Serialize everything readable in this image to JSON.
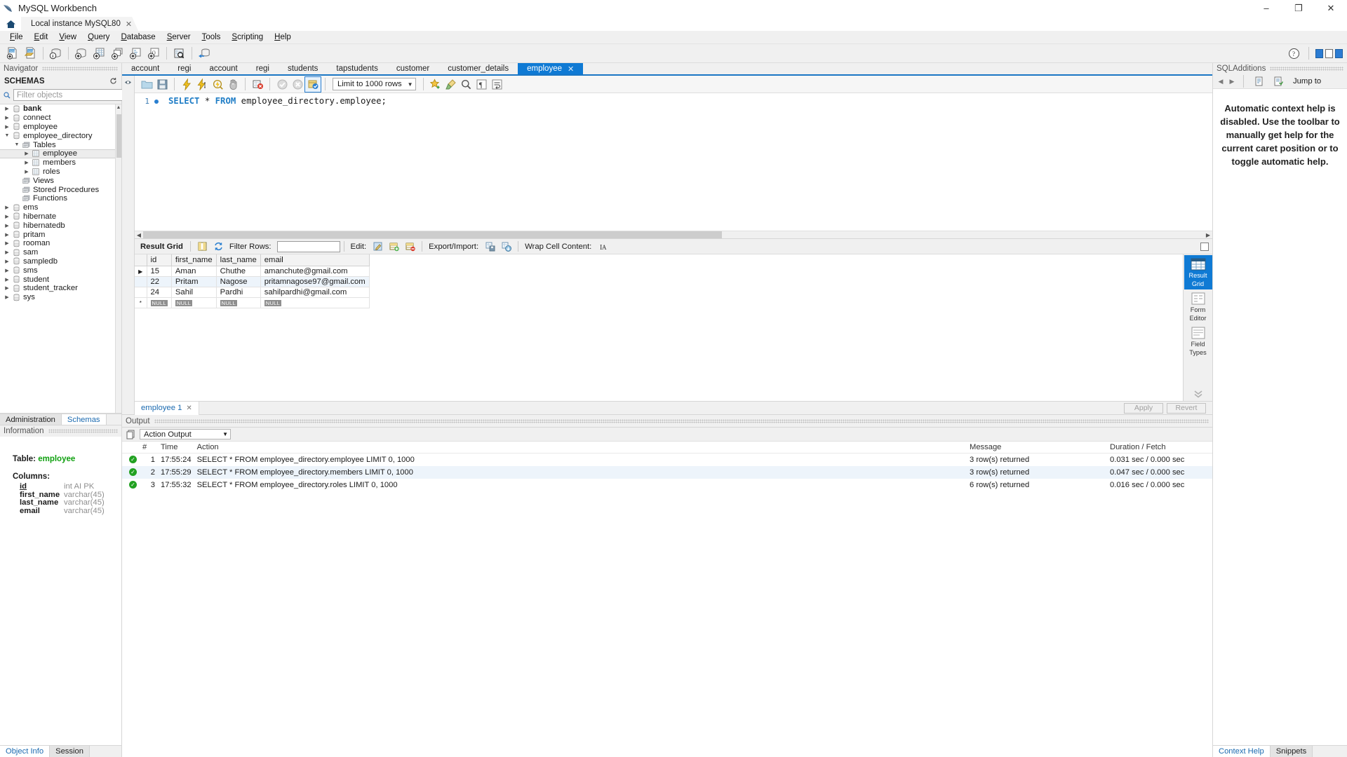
{
  "window": {
    "title": "MySQL Workbench",
    "minimize": "–",
    "maximize": "❐",
    "close": "✕"
  },
  "connection_tab": {
    "label": "Local instance MySQL80",
    "close": "✕"
  },
  "menu": [
    {
      "label": "File",
      "accel": "F"
    },
    {
      "label": "Edit",
      "accel": "E"
    },
    {
      "label": "View",
      "accel": "V"
    },
    {
      "label": "Query",
      "accel": "Q"
    },
    {
      "label": "Database",
      "accel": "D"
    },
    {
      "label": "Server",
      "accel": "S"
    },
    {
      "label": "Tools",
      "accel": "T"
    },
    {
      "label": "Scripting",
      "accel": "S"
    },
    {
      "label": "Help",
      "accel": "H"
    }
  ],
  "navigator": {
    "panel_title": "Navigator",
    "section_title": "SCHEMAS",
    "filter_placeholder": "Filter objects",
    "tree": [
      {
        "label": "bank",
        "indent": 0,
        "icon": "schema-icon",
        "arrow": "collapsed",
        "bold": true,
        "selected": false
      },
      {
        "label": "connect",
        "indent": 0,
        "icon": "schema-icon",
        "arrow": "collapsed",
        "bold": false,
        "selected": false
      },
      {
        "label": "employee",
        "indent": 0,
        "icon": "schema-icon",
        "arrow": "collapsed",
        "bold": false,
        "selected": false
      },
      {
        "label": "employee_directory",
        "indent": 0,
        "icon": "schema-icon",
        "arrow": "expanded",
        "bold": false,
        "selected": false
      },
      {
        "label": "Tables",
        "indent": 1,
        "icon": "folder-icon",
        "arrow": "expanded",
        "bold": false,
        "selected": false
      },
      {
        "label": "employee",
        "indent": 2,
        "icon": "table-icon",
        "arrow": "collapsed",
        "bold": false,
        "selected": true
      },
      {
        "label": "members",
        "indent": 2,
        "icon": "table-icon",
        "arrow": "collapsed",
        "bold": false,
        "selected": false
      },
      {
        "label": "roles",
        "indent": 2,
        "icon": "table-icon",
        "arrow": "collapsed",
        "bold": false,
        "selected": false
      },
      {
        "label": "Views",
        "indent": 1,
        "icon": "folder-icon",
        "arrow": "none",
        "bold": false,
        "selected": false
      },
      {
        "label": "Stored Procedures",
        "indent": 1,
        "icon": "folder-icon",
        "arrow": "none",
        "bold": false,
        "selected": false
      },
      {
        "label": "Functions",
        "indent": 1,
        "icon": "folder-icon",
        "arrow": "none",
        "bold": false,
        "selected": false
      },
      {
        "label": "ems",
        "indent": 0,
        "icon": "schema-icon",
        "arrow": "collapsed",
        "bold": false,
        "selected": false
      },
      {
        "label": "hibernate",
        "indent": 0,
        "icon": "schema-icon",
        "arrow": "collapsed",
        "bold": false,
        "selected": false
      },
      {
        "label": "hibernatedb",
        "indent": 0,
        "icon": "schema-icon",
        "arrow": "collapsed",
        "bold": false,
        "selected": false
      },
      {
        "label": "pritam",
        "indent": 0,
        "icon": "schema-icon",
        "arrow": "collapsed",
        "bold": false,
        "selected": false
      },
      {
        "label": "rooman",
        "indent": 0,
        "icon": "schema-icon",
        "arrow": "collapsed",
        "bold": false,
        "selected": false
      },
      {
        "label": "sam",
        "indent": 0,
        "icon": "schema-icon",
        "arrow": "collapsed",
        "bold": false,
        "selected": false
      },
      {
        "label": "sampledb",
        "indent": 0,
        "icon": "schema-icon",
        "arrow": "collapsed",
        "bold": false,
        "selected": false
      },
      {
        "label": "sms",
        "indent": 0,
        "icon": "schema-icon",
        "arrow": "collapsed",
        "bold": false,
        "selected": false
      },
      {
        "label": "student",
        "indent": 0,
        "icon": "schema-icon",
        "arrow": "collapsed",
        "bold": false,
        "selected": false
      },
      {
        "label": "student_tracker",
        "indent": 0,
        "icon": "schema-icon",
        "arrow": "collapsed",
        "bold": false,
        "selected": false
      },
      {
        "label": "sys",
        "indent": 0,
        "icon": "schema-icon",
        "arrow": "collapsed",
        "bold": false,
        "selected": false
      }
    ],
    "tabs": [
      {
        "label": "Administration",
        "active": false
      },
      {
        "label": "Schemas",
        "active": true
      }
    ]
  },
  "information": {
    "panel_title": "Information",
    "table_label": "Table:",
    "table_name": "employee",
    "columns_label": "Columns:",
    "columns": [
      {
        "name": "id",
        "type": "int AI PK",
        "pk": true
      },
      {
        "name": "first_name",
        "type": "varchar(45)",
        "pk": false
      },
      {
        "name": "last_name",
        "type": "varchar(45)",
        "pk": false
      },
      {
        "name": "email",
        "type": "varchar(45)",
        "pk": false
      }
    ],
    "tabs": [
      {
        "label": "Object Info",
        "active": true
      },
      {
        "label": "Session",
        "active": false
      }
    ]
  },
  "editor": {
    "tabs": [
      {
        "label": "account",
        "active": false
      },
      {
        "label": "regi",
        "active": false
      },
      {
        "label": "account",
        "active": false
      },
      {
        "label": "regi",
        "active": false
      },
      {
        "label": "students",
        "active": false
      },
      {
        "label": "tapstudents",
        "active": false
      },
      {
        "label": "customer",
        "active": false
      },
      {
        "label": "customer_details",
        "active": false
      },
      {
        "label": "employee",
        "active": true,
        "close": "✕"
      }
    ],
    "limit_label": "Limit to 1000 rows",
    "line_number": "1",
    "sql": {
      "full": "SELECT * FROM employee_directory.employee;",
      "kw1": "SELECT",
      "star": "*",
      "kw2": "FROM",
      "rest": "employee_directory.employee;"
    }
  },
  "result_toolbar": {
    "result_grid_label": "Result Grid",
    "filter_rows_label": "Filter Rows:",
    "filter_rows_value": "",
    "edit_label": "Edit:",
    "export_import_label": "Export/Import:",
    "wrap_cell_label": "Wrap Cell Content:"
  },
  "result_grid": {
    "columns": [
      "id",
      "first_name",
      "last_name",
      "email"
    ],
    "rows": [
      {
        "marker": "▶",
        "id": "15",
        "first_name": "Aman",
        "last_name": "Chuthe",
        "email": "amanchute@gmail.com"
      },
      {
        "marker": "",
        "id": "22",
        "first_name": "Pritam",
        "last_name": "Nagose",
        "email": "pritamnagose97@gmail.com"
      },
      {
        "marker": "",
        "id": "24",
        "first_name": "Sahil",
        "last_name": "Pardhi",
        "email": "sahilpardhi@gmail.com"
      },
      {
        "marker": "*",
        "id": "NULL",
        "first_name": "NULL",
        "last_name": "NULL",
        "email": "NULL",
        "is_new": true
      }
    ]
  },
  "result_sidebar": [
    {
      "label": "Result\nGrid",
      "line1": "Result",
      "line2": "Grid",
      "icon": "grid-icon",
      "active": true
    },
    {
      "label": "Form Editor",
      "line1": "Form",
      "line2": "Editor",
      "icon": "form-icon",
      "active": false
    },
    {
      "label": "Field Types",
      "line1": "Field",
      "line2": "Types",
      "icon": "field-types-icon",
      "active": false
    }
  ],
  "result_footer": {
    "tab_label": "employee 1",
    "tab_close": "✕",
    "apply": "Apply",
    "revert": "Revert"
  },
  "output": {
    "panel_title": "Output",
    "selector_value": "Action Output",
    "columns": [
      "#",
      "Time",
      "Action",
      "Message",
      "Duration / Fetch"
    ],
    "rows": [
      {
        "num": "1",
        "time": "17:55:24",
        "action": "SELECT * FROM employee_directory.employee LIMIT 0, 1000",
        "message": "3 row(s) returned",
        "duration": "0.031 sec / 0.000 sec",
        "status": "ok"
      },
      {
        "num": "2",
        "time": "17:55:29",
        "action": "SELECT * FROM employee_directory.members LIMIT 0, 1000",
        "message": "3 row(s) returned",
        "duration": "0.047 sec / 0.000 sec",
        "status": "ok"
      },
      {
        "num": "3",
        "time": "17:55:32",
        "action": "SELECT * FROM employee_directory.roles LIMIT 0, 1000",
        "message": "6 row(s) returned",
        "duration": "0.016 sec / 0.000 sec",
        "status": "ok"
      }
    ]
  },
  "sql_additions": {
    "panel_title": "SQLAdditions",
    "jump_to_label": "Jump to",
    "message": "Automatic context help is disabled. Use the toolbar to manually get help for the current caret position or to toggle automatic help.",
    "tabs": [
      {
        "label": "Context Help",
        "active": true
      },
      {
        "label": "Snippets",
        "active": false
      }
    ]
  },
  "colors": {
    "accent": "#0f7ad4",
    "keyword": "#1f7dc6",
    "success": "#21a121",
    "link": "#1b6ab0",
    "table_green": "#10a010"
  }
}
